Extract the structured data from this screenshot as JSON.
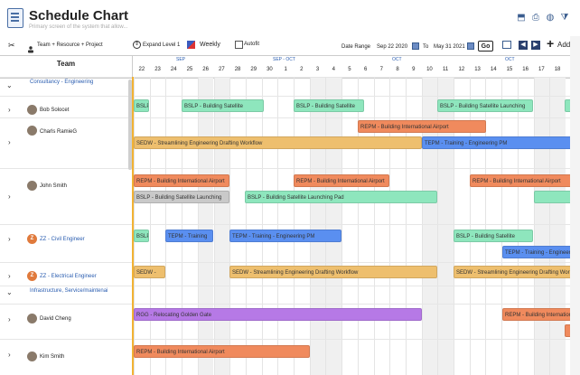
{
  "header": {
    "title": "Schedule Chart",
    "subtitle": "Primary screen of the system that allow...",
    "icons": [
      "export-icon",
      "print-icon",
      "globe-icon",
      "filter-icon"
    ]
  },
  "toolbar": {
    "grouping_label": "Team + Resource + Project",
    "expand_label": "Expand Level 1",
    "weekly_label": "Weekly",
    "autofit_label": "Autofit",
    "date_range_label": "Date Range",
    "start_date": "Sep 22 2020",
    "to_label": "To",
    "end_date": "May 31 2021",
    "go_label": "Go",
    "add_label": "Add"
  },
  "grid": {
    "team_header": "Team",
    "months": [
      "SEP",
      "SEP - OCT",
      "OCT",
      "OCT"
    ],
    "days": [
      "22",
      "23",
      "24",
      "25",
      "26",
      "27",
      "28",
      "29",
      "30",
      "1",
      "2",
      "3",
      "4",
      "5",
      "6",
      "7",
      "8",
      "9",
      "10",
      "11",
      "12",
      "13",
      "14",
      "15",
      "16",
      "17",
      "18"
    ]
  },
  "rows": {
    "group1": "Consultancy - Engineering",
    "r1": "Bob Solocet",
    "r2": "Charls RamieG",
    "r3": "John Smith",
    "r4": "ZZ - Civil Engineer",
    "r5": "ZZ - Electrical Engineer",
    "group2": "Infrastructure, Service/maintenai",
    "r6": "David Cheng",
    "r7": "Kim Smith",
    "z_letter": "Z"
  },
  "tasks": {
    "t1": "BSLP",
    "t2": "BSLP - Building Satellite",
    "t3": "BSLP - Building Satellite",
    "t4": "BSLP - Building Satellite Launching",
    "t5": "REPM - Building International Airport",
    "t6": "SEDW - Streamlining Engineering Drafting Workflow",
    "t7": "TEPM - Training - Engineering PM",
    "t8": "REPM - Building International Airport",
    "t9": "REPM - Building International Airport",
    "t10": "REPM - Building International Airport",
    "t11": "BSLP - Building Satellite Launching",
    "t12": "BSLP - Building Satellite Launching Pad",
    "t13": "BSLP",
    "t14": "TEPM - Training",
    "t15": "TEPM - Training - Engineering PM",
    "t16": "BSLP - Building Satellite",
    "t17": "TEPM - Training - Engineering",
    "t18": "SEDW -",
    "t19": "SEDW - Streamlining Engineering Drafting Workflow",
    "t20": "SEDW - Streamlining Engineering Drafting Workflow",
    "t21": "RGG - Relocating Golden Gate",
    "t22": "REPM - Building International",
    "t23": "REPM - Building International Airport"
  },
  "colors": {
    "green": "#8ee6bd",
    "orange": "#f08a5d",
    "yellow": "#eebf6e",
    "blue": "#5a8ff0",
    "purple": "#b679e6",
    "grey": "#c9c9c9",
    "today": "#f2b233"
  }
}
